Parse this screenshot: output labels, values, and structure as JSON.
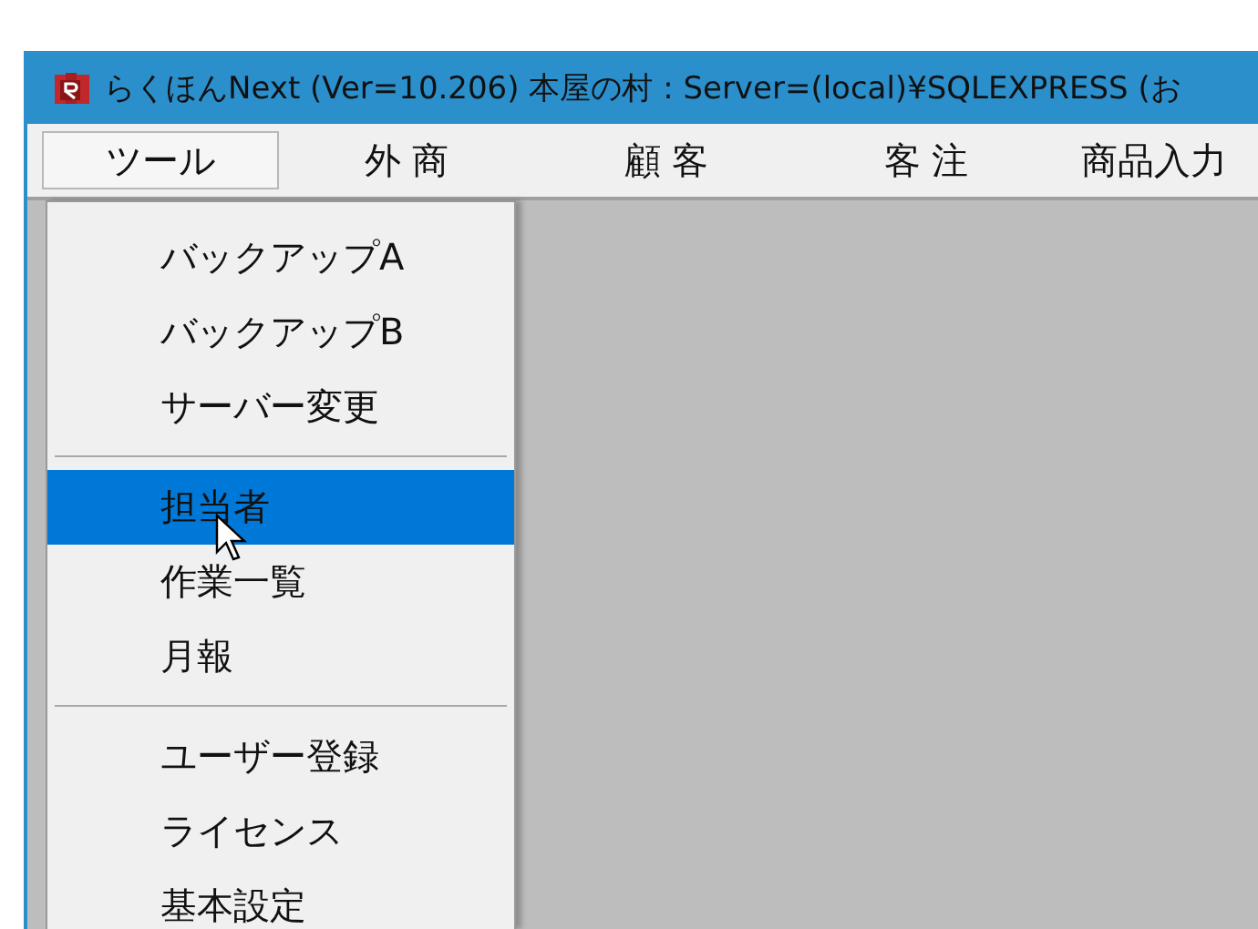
{
  "window": {
    "title": "らくほんNext (Ver=10.206)  本屋の村 : Server=(local)¥SQLEXPRESS (お"
  },
  "menu_bar": [
    {
      "label": "ツール",
      "selected": true
    },
    {
      "label": "外 商",
      "selected": false
    },
    {
      "label": "顧 客",
      "selected": false
    },
    {
      "label": "客 注",
      "selected": false
    },
    {
      "label": "商品入力",
      "selected": false
    }
  ],
  "dropdown": [
    {
      "kind": "item",
      "label": "バックアップA",
      "selected": false
    },
    {
      "kind": "item",
      "label": "バックアップB",
      "selected": false
    },
    {
      "kind": "item",
      "label": "サーバー変更",
      "selected": false
    },
    {
      "kind": "separator"
    },
    {
      "kind": "item",
      "label": "担当者",
      "selected": true
    },
    {
      "kind": "item",
      "label": "作業一覧",
      "selected": false
    },
    {
      "kind": "item",
      "label": "月報",
      "selected": false
    },
    {
      "kind": "separator"
    },
    {
      "kind": "item",
      "label": "ユーザー登録",
      "selected": false
    },
    {
      "kind": "item",
      "label": "ライセンス",
      "selected": false
    },
    {
      "kind": "item",
      "label": "基本設定",
      "selected": false
    }
  ]
}
